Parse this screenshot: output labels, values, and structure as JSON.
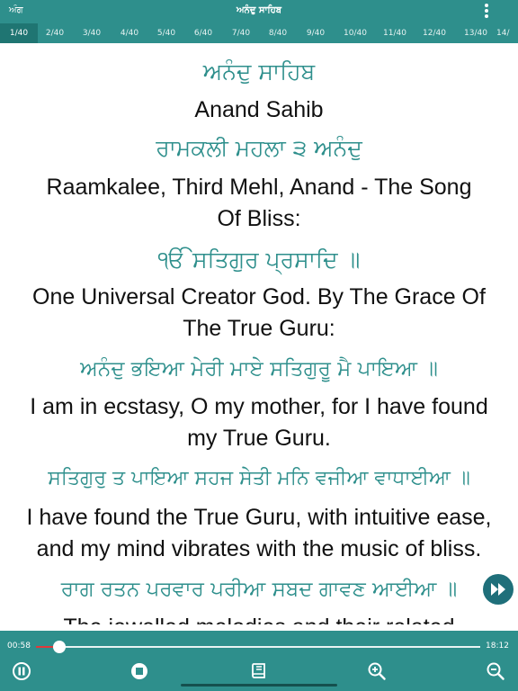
{
  "header": {
    "left_label": "ਅੰਗ",
    "title": "ਅਨੰਦੁ ਸਾਹਿਬ",
    "menu_icon": "more-vertical-icon"
  },
  "tabs": [
    "1/40",
    "2/40",
    "3/40",
    "4/40",
    "5/40",
    "6/40",
    "7/40",
    "8/40",
    "9/40",
    "10/40",
    "11/40",
    "12/40",
    "13/40",
    "14/"
  ],
  "active_tab": "1/40",
  "content": {
    "title_gurmukhi": "ਅਨੰਦੁ ਸਾਹਿਬ",
    "title_english": "Anand Sahib",
    "heading_gurmukhi": "ਰਾਮਕਲੀ ਮਹਲਾ ੩ ਅਨੰਦੁ",
    "heading_english_1": "Raamkalee, Third Mehl, Anand - The Song",
    "heading_english_2": "Of Bliss:",
    "mool_gurmukhi": "ੴ ਸਤਿਗੁਰ ਪ੍ਰਸਾਦਿ ॥",
    "mool_english_1": "One Universal Creator God. By The Grace Of",
    "mool_english_2": "The True Guru:",
    "line1_gurmukhi": "ਅਨੰਦੁ ਭਇਆ ਮੇਰੀ ਮਾਏ ਸਤਿਗੁਰੂ ਮੈ ਪਾਇਆ ॥",
    "line1_english_1": "I am in ecstasy, O my mother, for I have found",
    "line1_english_2": "my True Guru.",
    "line2_gurmukhi": "ਸਤਿਗੁਰੁ ਤ ਪਾਇਆ ਸਹਜ ਸੇਤੀ ਮਨਿ ਵਜੀਆ ਵਾਧਾਈਆ ॥",
    "line2_english_1": "I have found the True Guru, with intuitive ease,",
    "line2_english_2": "and my mind vibrates with the music of bliss.",
    "line3_gurmukhi": "ਰਾਗ ਰਤਨ ਪਰਵਾਰ ਪਰੀਆ ਸਬਦ ਗਾਵਣ ਆਈਆ ॥",
    "line3_english_1": "The jewelled melodies and their related"
  },
  "player": {
    "elapsed": "00:58",
    "duration": "18:12",
    "progress_fraction": 0.053,
    "buttons": [
      "pause-icon",
      "stop-icon",
      "book-icon",
      "zoom-in-icon",
      "zoom-out-icon"
    ],
    "fast_forward_icon": "fast-forward-icon"
  },
  "colors": {
    "theme": "#2e8f8c",
    "gurmukhi_text": "#2e8f8c",
    "progress_played": "#e0393b"
  }
}
